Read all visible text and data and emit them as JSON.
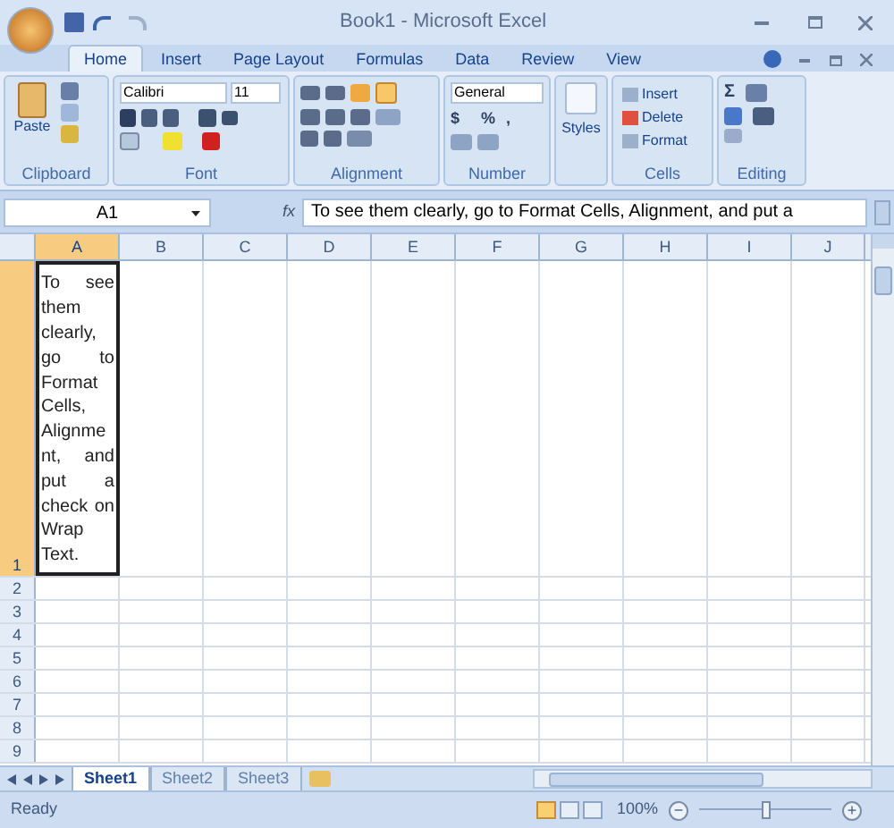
{
  "window": {
    "title": "Book1 - Microsoft Excel"
  },
  "ribbon_tabs": [
    {
      "label": "Home",
      "selected": true
    },
    {
      "label": "Insert",
      "selected": false
    },
    {
      "label": "Page Layout",
      "selected": false
    },
    {
      "label": "Formulas",
      "selected": false
    },
    {
      "label": "Data",
      "selected": false
    },
    {
      "label": "Review",
      "selected": false
    },
    {
      "label": "View",
      "selected": false
    }
  ],
  "clipboard": {
    "paste": "Paste",
    "label": "Clipboard"
  },
  "font": {
    "name": "Calibri",
    "size": "11",
    "label": "Font"
  },
  "alignment": {
    "label": "Alignment",
    "wrap_text_on": true
  },
  "number": {
    "format": "General",
    "currency": "$",
    "percent": "%",
    "comma": ",",
    "label": "Number"
  },
  "styles": {
    "label": "Styles"
  },
  "cells": {
    "buttons": [
      "Insert",
      "Delete",
      "Format"
    ],
    "label": "Cells"
  },
  "editing": {
    "sum": "Σ",
    "label": "Editing"
  },
  "formula_bar": {
    "name_box": "A1",
    "fx": "fx",
    "content": "To see them clearly, go to Format Cells, Alignment, and put a"
  },
  "columns": [
    {
      "label": "A",
      "selected": true
    },
    {
      "label": "B",
      "selected": false
    },
    {
      "label": "C",
      "selected": false
    },
    {
      "label": "D",
      "selected": false
    },
    {
      "label": "E",
      "selected": false
    },
    {
      "label": "F",
      "selected": false
    },
    {
      "label": "G",
      "selected": false
    },
    {
      "label": "H",
      "selected": false
    },
    {
      "label": "I",
      "selected": false
    },
    {
      "label": "J",
      "selected": false
    }
  ],
  "rows": [
    {
      "label": "1",
      "selected": true,
      "cell_a": "To see them clearly, go to Format Cells, Alignment, and put a check on Wrap Text."
    },
    {
      "label": "2",
      "selected": false
    },
    {
      "label": "3",
      "selected": false
    },
    {
      "label": "4",
      "selected": false
    },
    {
      "label": "5",
      "selected": false
    },
    {
      "label": "6",
      "selected": false
    },
    {
      "label": "7",
      "selected": false
    },
    {
      "label": "8",
      "selected": false
    },
    {
      "label": "9",
      "selected": false
    }
  ],
  "sheet_tabs": [
    {
      "label": "Sheet1",
      "selected": true
    },
    {
      "label": "Sheet2",
      "selected": false
    },
    {
      "label": "Sheet3",
      "selected": false
    }
  ],
  "status_bar": {
    "status": "Ready",
    "zoom": "100%",
    "zoom_minus": "−",
    "zoom_plus": "+",
    "level": 0.5
  }
}
